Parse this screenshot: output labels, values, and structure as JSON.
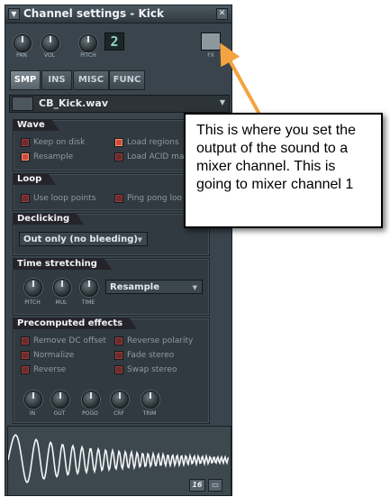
{
  "window": {
    "title": "Channel settings - Kick",
    "menu_icon": "triangle-down-icon",
    "close_icon": "close-x-icon"
  },
  "top_knobs": {
    "pan_label": "PAN",
    "vol_label": "VOL",
    "pitch_label": "PITCH",
    "pitch_display": "2",
    "fx_display": "",
    "fx_label": "FX"
  },
  "tabs": [
    {
      "label": "SMP"
    },
    {
      "label": "INS"
    },
    {
      "label": "MISC"
    },
    {
      "label": "FUNC"
    }
  ],
  "sample": {
    "filename": "CB_Kick.wav"
  },
  "wave_panel": {
    "title": "Wave",
    "keep_on_disk": "Keep on disk",
    "resample": "Resample",
    "load_regions": "Load regions",
    "load_acid": "Load ACID ma"
  },
  "loop_panel": {
    "title": "Loop",
    "use_loop_points": "Use loop points",
    "ping_pong": "Ping pong loo"
  },
  "declicking_panel": {
    "title": "Declicking",
    "mode": "Out only (no bleeding)"
  },
  "time_stretching_panel": {
    "title": "Time stretching",
    "pitch_label": "PITCH",
    "mul_label": "MUL",
    "time_label": "TIME",
    "mode": "Resample"
  },
  "precomputed_panel": {
    "title": "Precomputed effects",
    "remove_dc": "Remove DC offset",
    "reverse_polarity": "Reverse polarity",
    "normalize": "Normalize",
    "fade_stereo": "Fade stereo",
    "reverse": "Reverse",
    "swap_stereo": "Swap stereo",
    "in_label": "IN",
    "out_label": "OUT",
    "pogo_label": "POGO",
    "crf_label": "CRF",
    "trim_label": "TRIM"
  },
  "waveform": {
    "bits_badge": "16"
  },
  "annotation": {
    "text": "This is where you set the output of the sound to a mixer channel. This is going to mixer channel 1",
    "arrow_color": "#f5a340"
  }
}
